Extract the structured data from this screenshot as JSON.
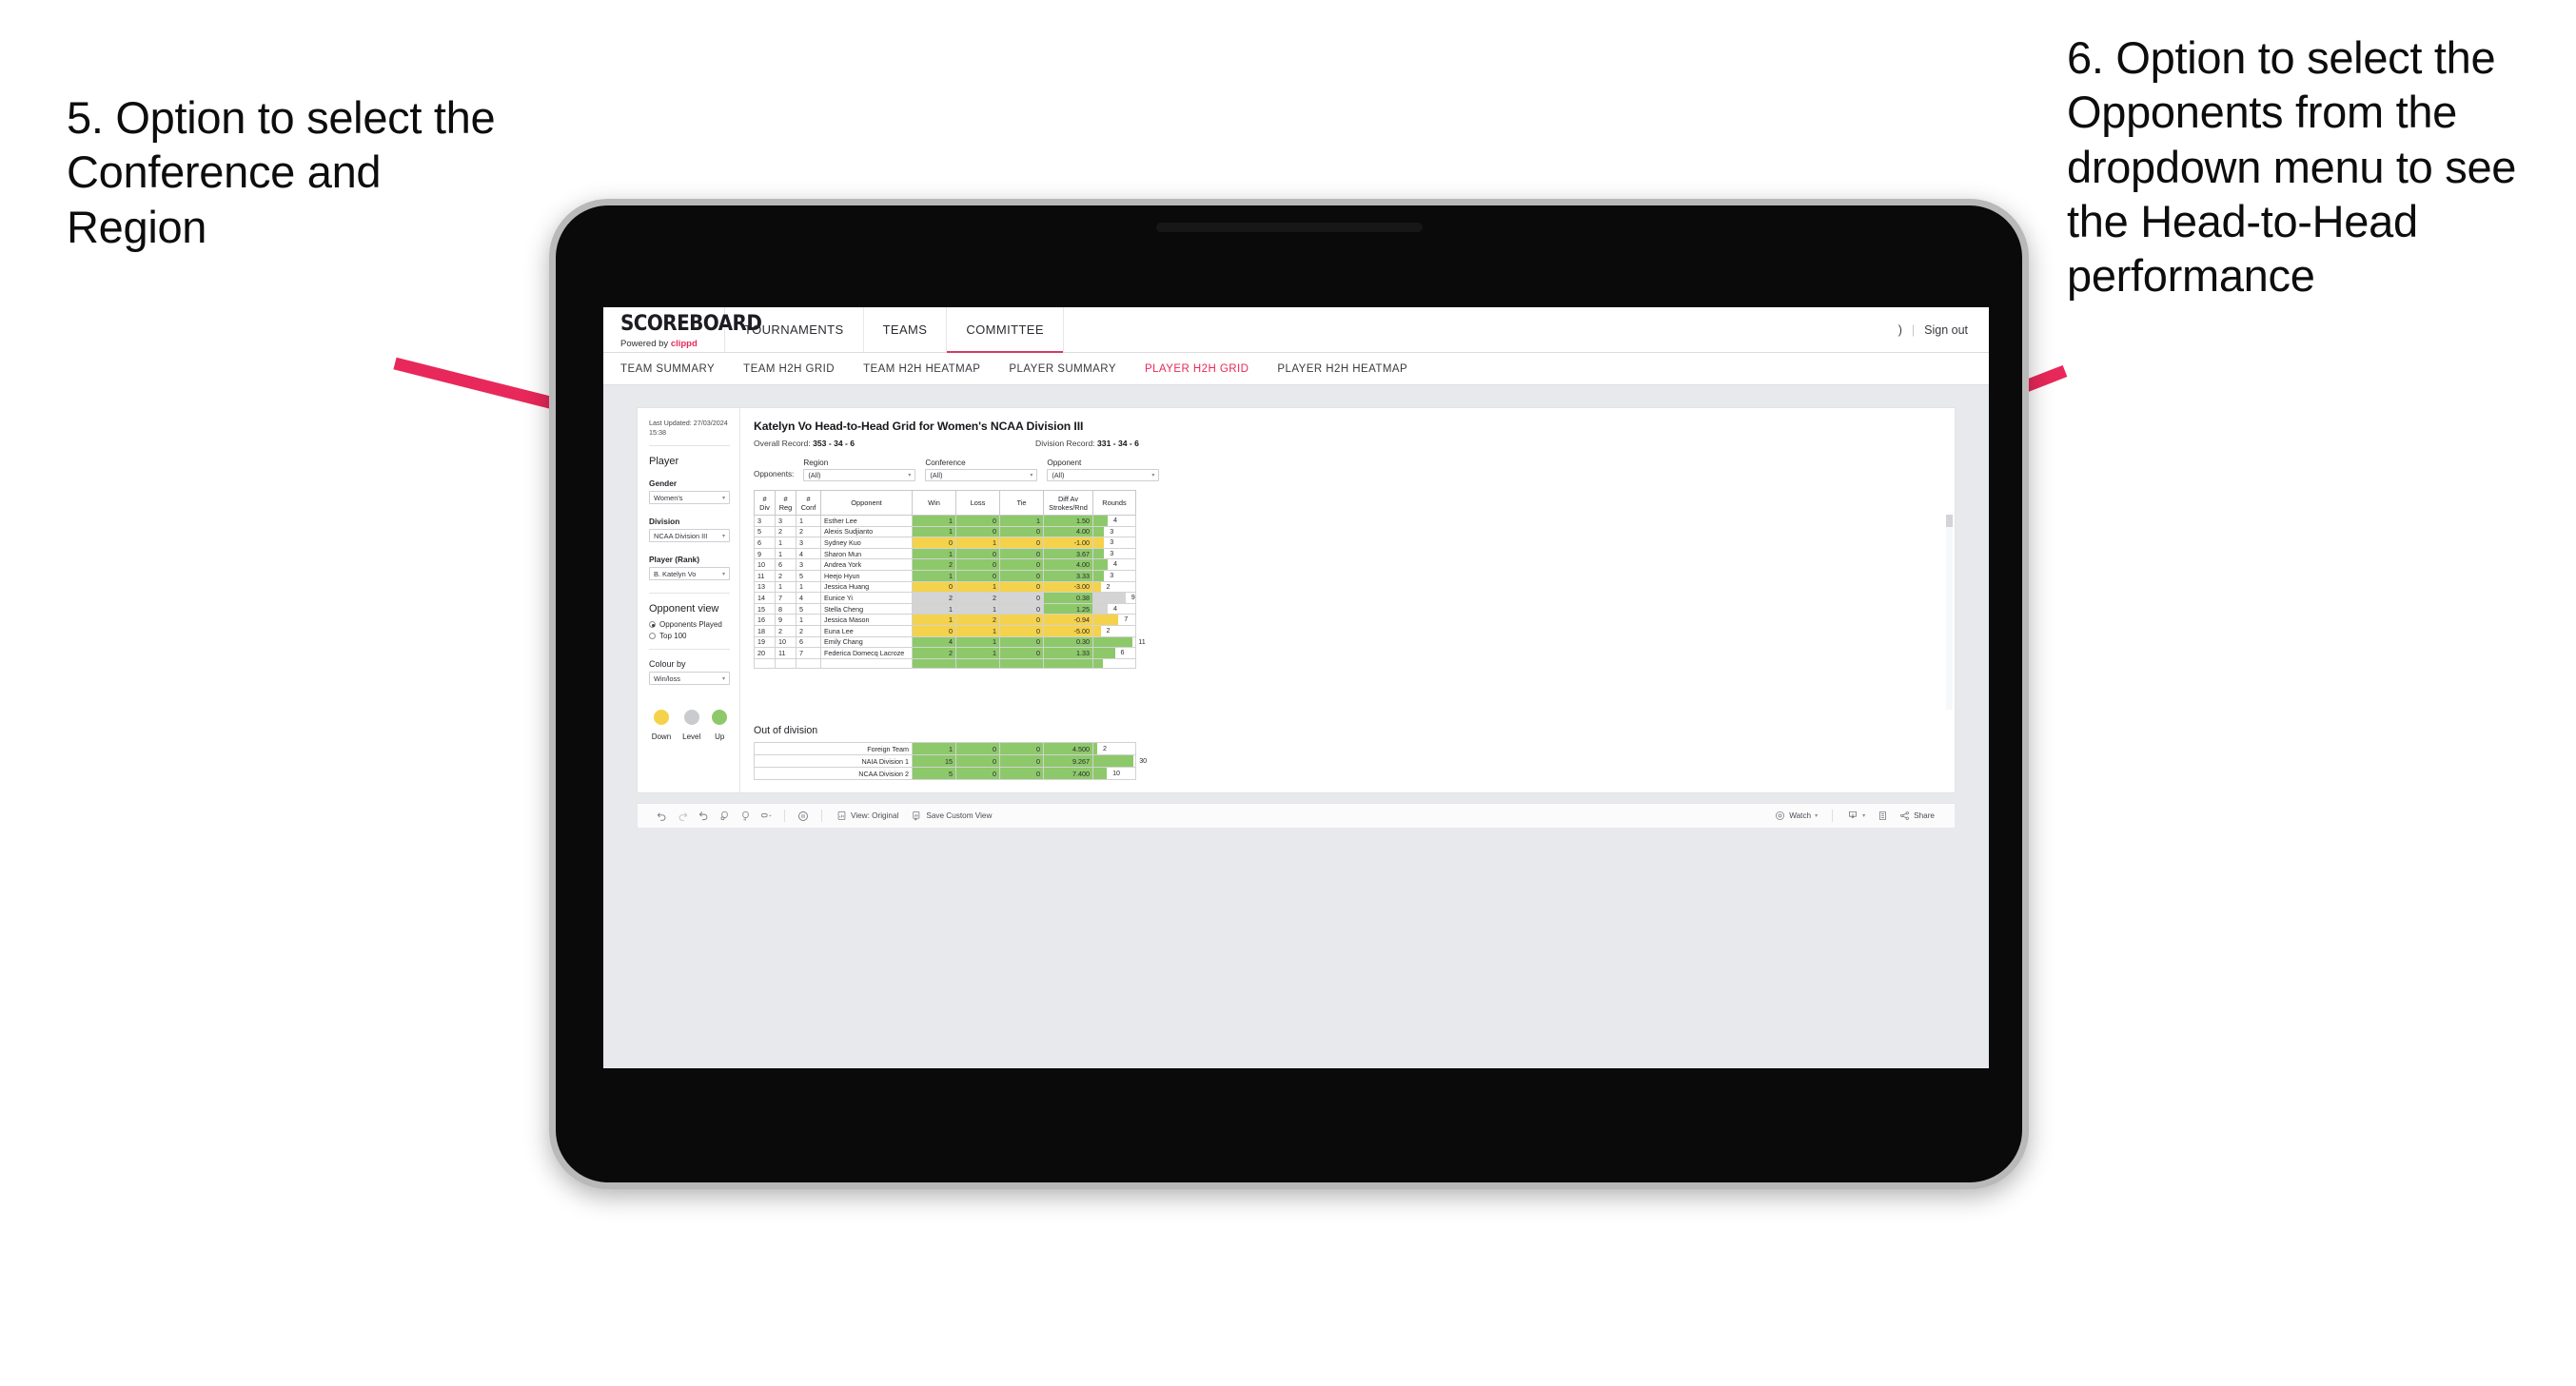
{
  "annotations": {
    "left": "5. Option to select the Conference and Region",
    "right": "6. Option to select the Opponents from the dropdown menu to see the Head-to-Head performance"
  },
  "colors": {
    "accent_pink": "#e8285a",
    "arrow_pink": "#e8285a",
    "up_green": "#8DC96A",
    "down_yellow": "#F5D24B",
    "level_gray": "#D4D4D4"
  },
  "app": {
    "logo": {
      "main": "SCOREBOARD",
      "powered_prefix": "Powered by ",
      "brand": "clippd"
    },
    "topnav": [
      {
        "label": "TOURNAMENTS",
        "active": false
      },
      {
        "label": "TEAMS",
        "active": false
      },
      {
        "label": "COMMITTEE",
        "active": true
      }
    ],
    "topbar_right": {
      "user": ")",
      "separator": "|",
      "signout": "Sign out"
    },
    "subnav": [
      {
        "label": "TEAM SUMMARY",
        "selected": false
      },
      {
        "label": "TEAM H2H GRID",
        "selected": false
      },
      {
        "label": "TEAM H2H HEATMAP",
        "selected": false
      },
      {
        "label": "PLAYER SUMMARY",
        "selected": false
      },
      {
        "label": "PLAYER H2H GRID",
        "selected": true
      },
      {
        "label": "PLAYER H2H HEATMAP",
        "selected": false
      }
    ]
  },
  "sidebar": {
    "last_updated": "Last Updated: 27/03/2024 15:38",
    "player_heading": "Player",
    "fields": [
      {
        "label": "Gender",
        "value": "Women's"
      },
      {
        "label": "Division",
        "value": "NCAA Division III"
      },
      {
        "label": "Player (Rank)",
        "value": "B. Katelyn Vo"
      }
    ],
    "opponent_view": {
      "heading": "Opponent view",
      "options": [
        {
          "label": "Opponents Played",
          "selected": true
        },
        {
          "label": "Top 100",
          "selected": false
        }
      ]
    },
    "colour_by": {
      "label": "Colour by",
      "value": "Win/loss"
    },
    "legend": [
      {
        "label": "Down",
        "color": "#F5D24B"
      },
      {
        "label": "Level",
        "color": "#C9CBCE"
      },
      {
        "label": "Up",
        "color": "#8DC96A"
      }
    ]
  },
  "view": {
    "title": "Katelyn Vo Head-to-Head Grid for Women's NCAA Division III",
    "overall_record_label": "Overall Record:",
    "overall_record_value": "353 - 34 - 6",
    "division_record_label": "Division Record:",
    "division_record_value": "331 - 34 - 6",
    "filters": {
      "lead_label": "Opponents:",
      "items": [
        {
          "label": "Region",
          "value": "(All)"
        },
        {
          "label": "Conference",
          "value": "(All)"
        },
        {
          "label": "Opponent",
          "value": "(All)"
        }
      ]
    }
  },
  "chart_data": {
    "type": "table",
    "title": "Katelyn Vo Head-to-Head Grid for Women's NCAA Division III",
    "columns": [
      "# Div",
      "# Reg",
      "# Conf",
      "Opponent",
      "Win",
      "Loss",
      "Tie",
      "Diff Av Strokes/Rnd",
      "Rounds"
    ],
    "rounds_max": 12,
    "rows": [
      {
        "div": "3",
        "reg": "3",
        "conf": "1",
        "opponent": "Esther Lee",
        "win": "1",
        "loss": "0",
        "tie": "1",
        "diff": "1.50",
        "rounds": 4,
        "state": "up"
      },
      {
        "div": "5",
        "reg": "2",
        "conf": "2",
        "opponent": "Alexis Sudjianto",
        "win": "1",
        "loss": "0",
        "tie": "0",
        "diff": "4.00",
        "rounds": 3,
        "state": "up"
      },
      {
        "div": "6",
        "reg": "1",
        "conf": "3",
        "opponent": "Sydney Kuo",
        "win": "0",
        "loss": "1",
        "tie": "0",
        "diff": "-1.00",
        "rounds": 3,
        "state": "down"
      },
      {
        "div": "9",
        "reg": "1",
        "conf": "4",
        "opponent": "Sharon Mun",
        "win": "1",
        "loss": "0",
        "tie": "0",
        "diff": "3.67",
        "rounds": 3,
        "state": "up"
      },
      {
        "div": "10",
        "reg": "6",
        "conf": "3",
        "opponent": "Andrea York",
        "win": "2",
        "loss": "0",
        "tie": "0",
        "diff": "4.00",
        "rounds": 4,
        "state": "up"
      },
      {
        "div": "11",
        "reg": "2",
        "conf": "5",
        "opponent": "Heejo Hyun",
        "win": "1",
        "loss": "0",
        "tie": "0",
        "diff": "3.33",
        "rounds": 3,
        "state": "up"
      },
      {
        "div": "13",
        "reg": "1",
        "conf": "1",
        "opponent": "Jessica Huang",
        "win": "0",
        "loss": "1",
        "tie": "0",
        "diff": "-3.00",
        "rounds": 2,
        "state": "down"
      },
      {
        "div": "14",
        "reg": "7",
        "conf": "4",
        "opponent": "Eunice Yi",
        "win": "2",
        "loss": "2",
        "tie": "0",
        "diff": "0.38",
        "rounds": 9,
        "state": "level",
        "diff_state": "up"
      },
      {
        "div": "15",
        "reg": "8",
        "conf": "5",
        "opponent": "Stella Cheng",
        "win": "1",
        "loss": "1",
        "tie": "0",
        "diff": "1.25",
        "rounds": 4,
        "state": "level",
        "diff_state": "up"
      },
      {
        "div": "16",
        "reg": "9",
        "conf": "1",
        "opponent": "Jessica Mason",
        "win": "1",
        "loss": "2",
        "tie": "0",
        "diff": "-0.94",
        "rounds": 7,
        "state": "down"
      },
      {
        "div": "18",
        "reg": "2",
        "conf": "2",
        "opponent": "Euna Lee",
        "win": "0",
        "loss": "1",
        "tie": "0",
        "diff": "-5.00",
        "rounds": 2,
        "state": "down"
      },
      {
        "div": "19",
        "reg": "10",
        "conf": "6",
        "opponent": "Emily Chang",
        "win": "4",
        "loss": "1",
        "tie": "0",
        "diff": "0.30",
        "rounds": 11,
        "state": "up"
      },
      {
        "div": "20",
        "reg": "11",
        "conf": "7",
        "opponent": "Federica Domecq Lacroze",
        "win": "2",
        "loss": "1",
        "tie": "0",
        "diff": "1.33",
        "rounds": 6,
        "state": "up"
      }
    ],
    "out_of_division": {
      "title": "Out of division",
      "rows": [
        {
          "name": "Foreign Team",
          "win": "1",
          "loss": "0",
          "tie": "0",
          "diff": "4.500",
          "rounds": 2,
          "state": "up"
        },
        {
          "name": "NAIA Division 1",
          "win": "15",
          "loss": "0",
          "tie": "0",
          "diff": "9.267",
          "rounds": 30,
          "state": "up"
        },
        {
          "name": "NCAA Division 2",
          "win": "5",
          "loss": "0",
          "tie": "0",
          "diff": "7.400",
          "rounds": 10,
          "state": "up"
        }
      ],
      "rounds_max": 32
    }
  },
  "toolbar": {
    "icons": [
      "undo-icon",
      "redo-icon",
      "revert-icon",
      "refresh-icon",
      "pause-icon",
      "collapse-icon"
    ],
    "view_label": "View: Original",
    "save_custom_view_label": "Save Custom View",
    "watch_label": "Watch",
    "share_label": "Share"
  }
}
